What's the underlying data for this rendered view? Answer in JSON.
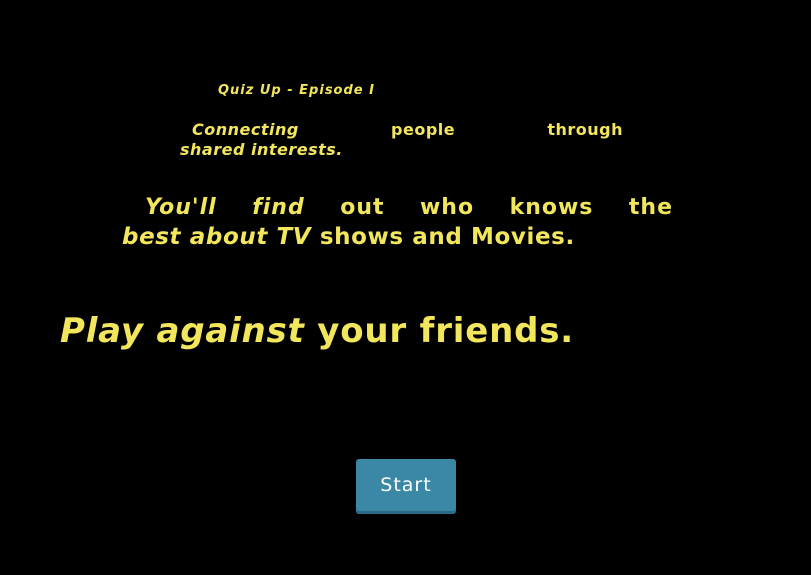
{
  "crawl": {
    "line1": {
      "part1": "Quiz Up",
      "part2": "- Episode I"
    },
    "line2": {
      "word1": "Connecting",
      "word2": "people",
      "word3": "through"
    },
    "line3": "shared interests.",
    "line4": {
      "w1": "You'll",
      "w2": "find",
      "w3": "out",
      "w4": "who",
      "w5": "knows",
      "w6": "the"
    },
    "line5": {
      "italic": "best about TV",
      "plain": "shows and Movies."
    },
    "line6": {
      "italic": "Play against",
      "plain": "your friends."
    }
  },
  "start_button": {
    "label": "Start"
  },
  "colors": {
    "background": "#000000",
    "crawl_text": "#f2e65c",
    "button_bg": "#3a88a6",
    "button_text": "#ffffff"
  }
}
